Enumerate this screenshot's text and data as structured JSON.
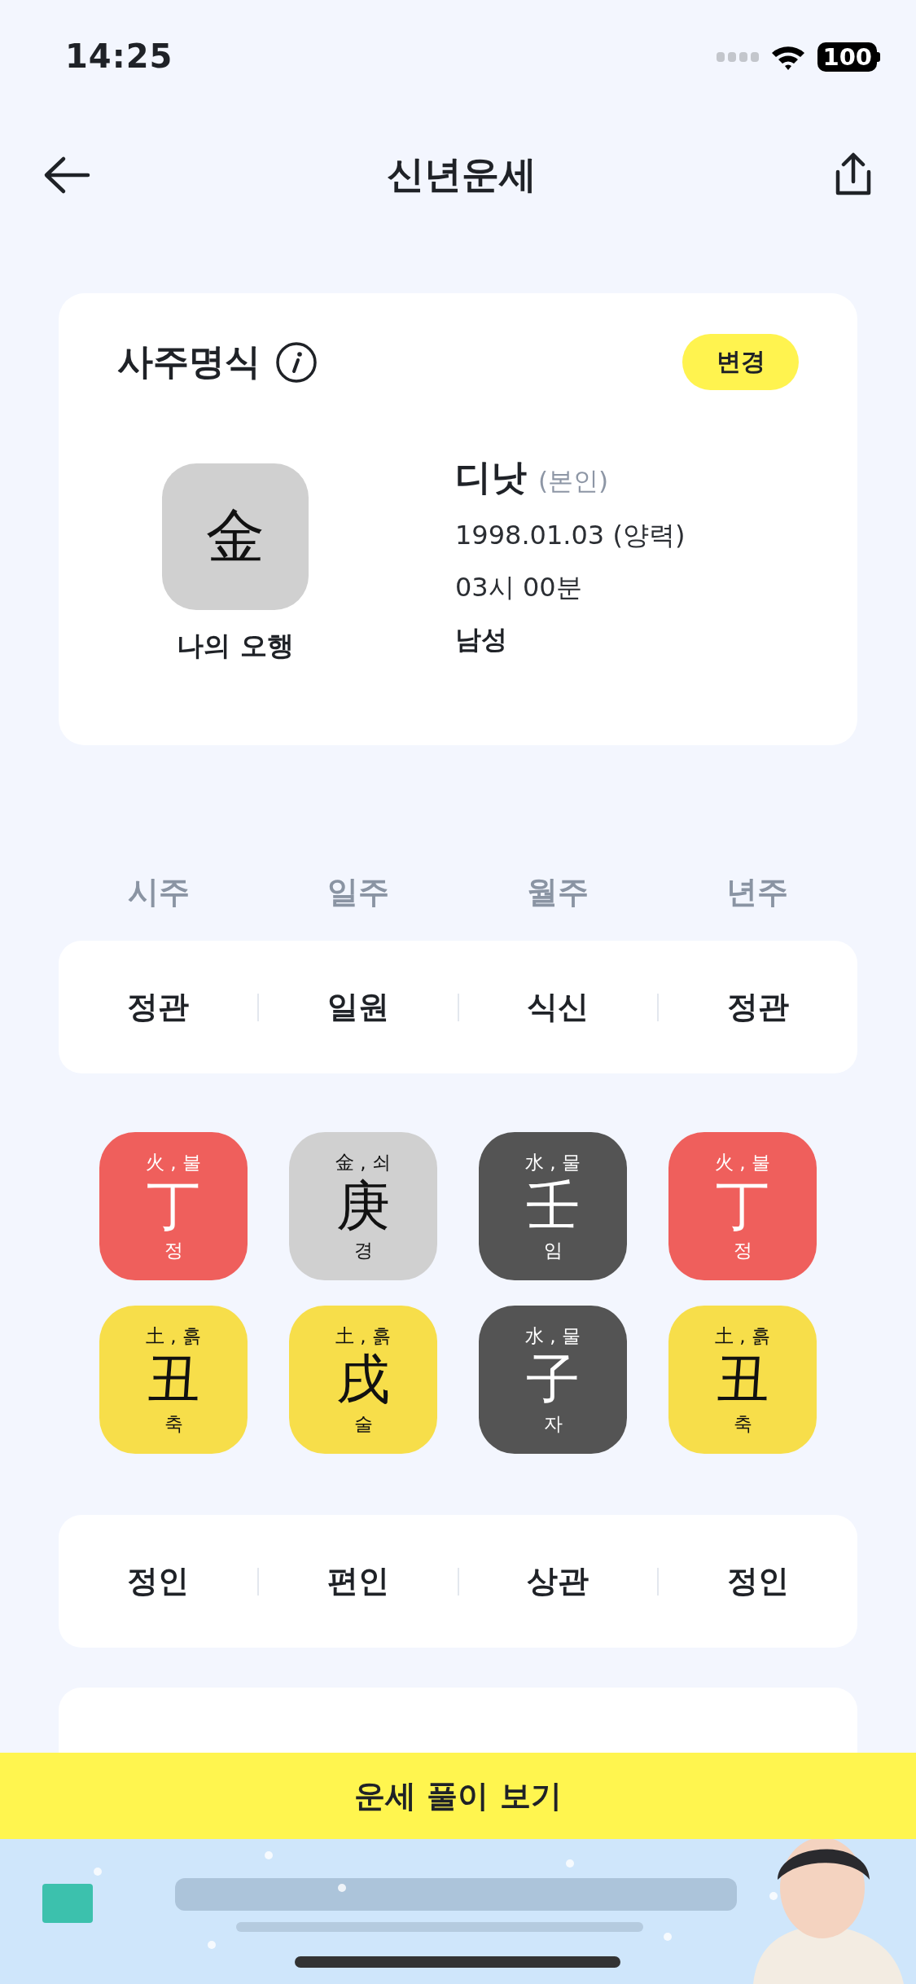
{
  "status_bar": {
    "time": "14:25",
    "battery": "100"
  },
  "nav": {
    "title": "신년운세"
  },
  "profile_card": {
    "title": "사주명식",
    "change_button": "변경",
    "element": {
      "symbol": "金",
      "color": "#d0d0d0"
    },
    "element_label": "나의 오행",
    "name": "디낫",
    "relation": "(본인)",
    "birth_date": "1998.01.03 (양력)",
    "birth_time": "03시 00분",
    "gender": "남성"
  },
  "pillar_headers": [
    "시주",
    "일주",
    "월주",
    "년주"
  ],
  "stem_ten_gods": [
    "정관",
    "일원",
    "식신",
    "정관"
  ],
  "stems": [
    {
      "element": "火 , 불",
      "hanja": "丁",
      "reading": "정",
      "color": "#ef5f5c"
    },
    {
      "element": "金 , 쇠",
      "hanja": "庚",
      "reading": "경",
      "color": "#d0d0d0"
    },
    {
      "element": "水 , 물",
      "hanja": "壬",
      "reading": "임",
      "color": "#545454"
    },
    {
      "element": "火 , 불",
      "hanja": "丁",
      "reading": "정",
      "color": "#ef5f5c"
    }
  ],
  "branches": [
    {
      "element": "土 , 흙",
      "hanja": "丑",
      "reading": "축",
      "color": "#f7de4a"
    },
    {
      "element": "土 , 흙",
      "hanja": "戌",
      "reading": "술",
      "color": "#f7de4a"
    },
    {
      "element": "水 , 물",
      "hanja": "子",
      "reading": "자",
      "color": "#545454"
    },
    {
      "element": "土 , 흙",
      "hanja": "丑",
      "reading": "축",
      "color": "#f7de4a"
    }
  ],
  "branch_ten_gods": [
    "정인",
    "편인",
    "상관",
    "정인"
  ],
  "action_button": "운세 풀이 보기"
}
